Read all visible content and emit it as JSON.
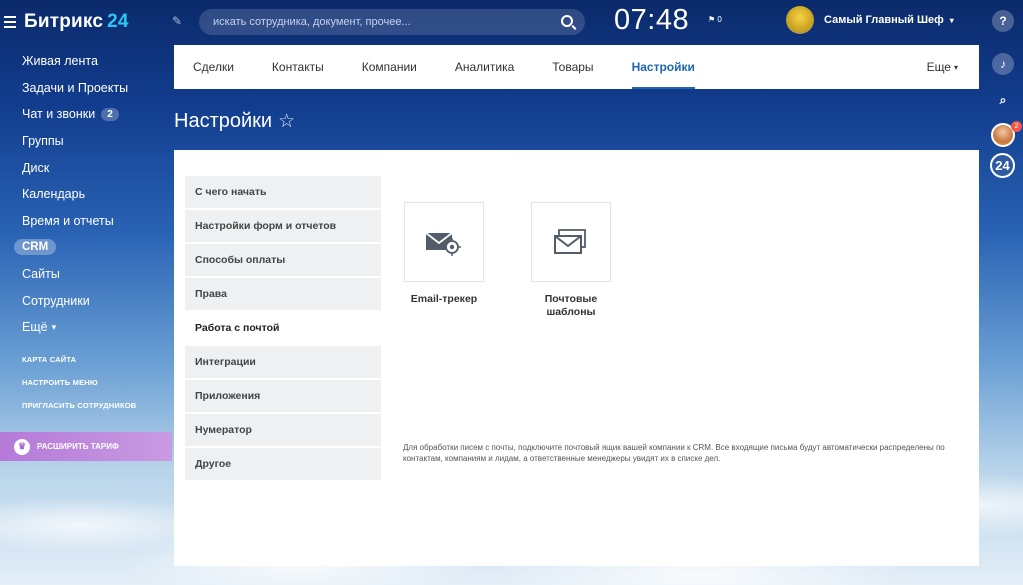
{
  "app": {
    "logo_text": "Битрикс",
    "logo_num": "24"
  },
  "search": {
    "placeholder": "искать сотрудника, документ, прочее..."
  },
  "clock": "07:48",
  "flag_count": "0",
  "user": {
    "name": "Самый Главный Шеф"
  },
  "sidebar": {
    "items": [
      {
        "label": "Живая лента"
      },
      {
        "label": "Задачи и Проекты"
      },
      {
        "label": "Чат и звонки",
        "badge": "2"
      },
      {
        "label": "Группы"
      },
      {
        "label": "Диск"
      },
      {
        "label": "Календарь"
      },
      {
        "label": "Время и отчеты"
      },
      {
        "label": "CRM"
      },
      {
        "label": "Сайты"
      },
      {
        "label": "Сотрудники"
      },
      {
        "label": "Ещё"
      }
    ],
    "links": [
      "КАРТА САЙТА",
      "НАСТРОИТЬ МЕНЮ",
      "ПРИГЛАСИТЬ СОТРУДНИКОВ"
    ],
    "upgrade_label": "РАСШИРИТЬ ТАРИФ"
  },
  "right_strip": {
    "help": "?",
    "notifications_badge": "2",
    "b24": "24"
  },
  "tabs": {
    "items": [
      "Сделки",
      "Контакты",
      "Компании",
      "Аналитика",
      "Товары",
      "Настройки"
    ],
    "active": "Настройки",
    "more_label": "Еще"
  },
  "page_title": "Настройки",
  "settings_menu": [
    "С чего начать",
    "Настройки форм и отчетов",
    "Способы оплаты",
    "Права",
    "Работа с почтой",
    "Интеграции",
    "Приложения",
    "Нумератор",
    "Другое"
  ],
  "settings_active_index": 4,
  "tiles": [
    {
      "label": "Email-трекер",
      "icon": "email-tracker-icon"
    },
    {
      "label": "Почтовые шаблоны",
      "icon": "mail-templates-icon"
    }
  ],
  "hint": "Для обработки писем с почты, подключите почтовый ящик вашей компании к CRM. Все входящие письма будут автоматически распределены по контактам, компаниям и лидам, а ответственные менеджеры увидят их в списке дел.",
  "colors": {
    "accent": "#2067b0",
    "upgrade": "#b57ad8",
    "logo_num": "#2fc6f6"
  }
}
